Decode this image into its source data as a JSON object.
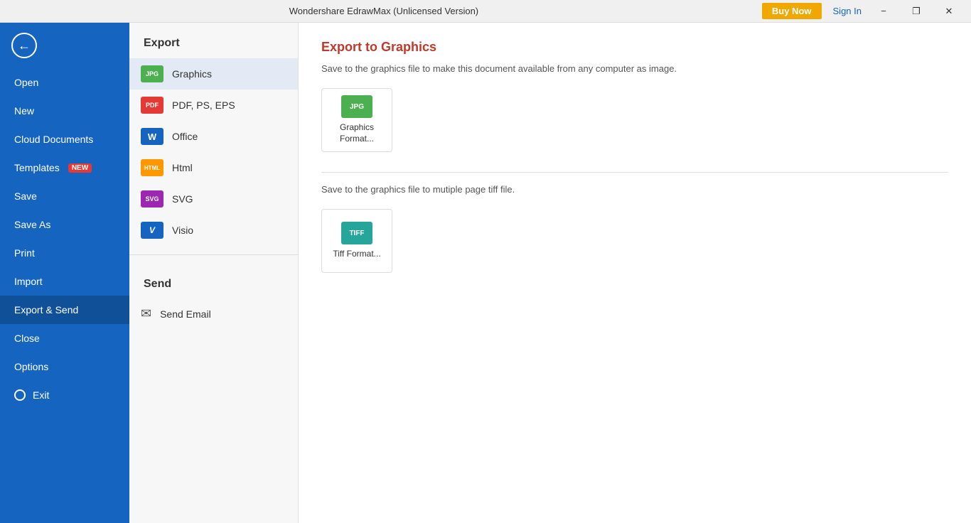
{
  "titlebar": {
    "title": "Wondershare EdrawMax (Unlicensed Version)",
    "buy_now": "Buy Now",
    "sign_in": "Sign In",
    "minimize": "−",
    "restore": "❐",
    "close": "✕"
  },
  "sidebar": {
    "back_label": "Back",
    "items": [
      {
        "id": "open",
        "label": "Open",
        "badge": null
      },
      {
        "id": "new",
        "label": "New",
        "badge": null
      },
      {
        "id": "cloud-documents",
        "label": "Cloud Documents",
        "badge": null
      },
      {
        "id": "templates",
        "label": "Templates",
        "badge": "NEW"
      },
      {
        "id": "save",
        "label": "Save",
        "badge": null
      },
      {
        "id": "save-as",
        "label": "Save As",
        "badge": null
      },
      {
        "id": "print",
        "label": "Print",
        "badge": null
      },
      {
        "id": "import",
        "label": "Import",
        "badge": null
      },
      {
        "id": "export-send",
        "label": "Export & Send",
        "badge": null
      },
      {
        "id": "close",
        "label": "Close",
        "badge": null
      },
      {
        "id": "options",
        "label": "Options",
        "badge": null
      },
      {
        "id": "exit",
        "label": "Exit",
        "badge": null
      }
    ]
  },
  "left_panel": {
    "export_title": "Export",
    "export_options": [
      {
        "id": "graphics",
        "label": "Graphics",
        "icon_text": "JPG",
        "icon_class": "icon-jpg"
      },
      {
        "id": "pdf",
        "label": "PDF, PS, EPS",
        "icon_text": "PDF",
        "icon_class": "icon-pdf"
      },
      {
        "id": "office",
        "label": "Office",
        "icon_text": "W",
        "icon_class": "icon-word"
      },
      {
        "id": "html",
        "label": "Html",
        "icon_text": "HTML",
        "icon_class": "icon-html"
      },
      {
        "id": "svg",
        "label": "SVG",
        "icon_text": "SVG",
        "icon_class": "icon-svg"
      },
      {
        "id": "visio",
        "label": "Visio",
        "icon_text": "V",
        "icon_class": "icon-visio"
      }
    ],
    "send_title": "Send",
    "send_options": [
      {
        "id": "send-email",
        "label": "Send Email",
        "icon": "envelope"
      }
    ]
  },
  "right_panel": {
    "title": "Export to Graphics",
    "description1": "Save to the graphics file to make this document available from any computer as image.",
    "description2": "Save to the graphics file to mutiple page tiff file.",
    "formats": [
      {
        "id": "graphics-format",
        "badge_text": "JPG",
        "badge_class": "badge-jpg",
        "label": "Graphics Format..."
      },
      {
        "id": "tiff-format",
        "badge_text": "TIFF",
        "badge_class": "badge-tiff",
        "label": "Tiff Format..."
      }
    ]
  }
}
